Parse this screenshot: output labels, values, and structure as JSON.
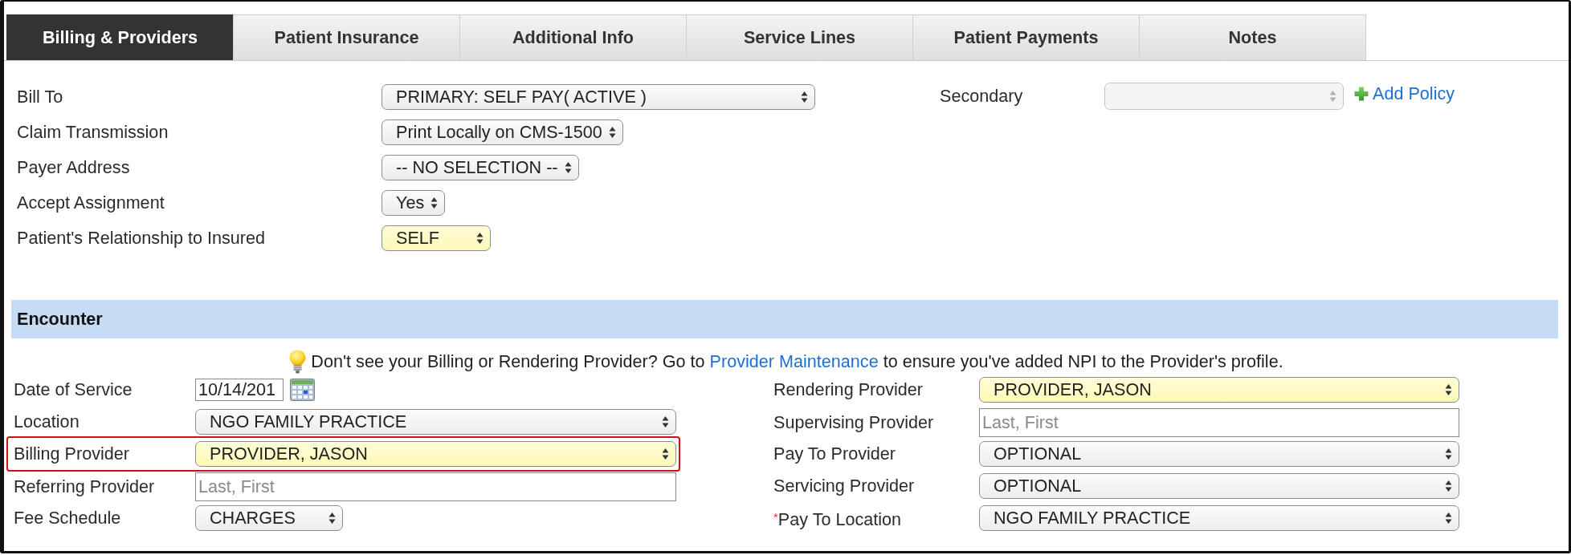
{
  "tabs": [
    {
      "label": "Billing & Providers",
      "selected": true
    },
    {
      "label": "Patient Insurance",
      "selected": false
    },
    {
      "label": "Additional Info",
      "selected": false
    },
    {
      "label": "Service Lines",
      "selected": false
    },
    {
      "label": "Patient Payments",
      "selected": false
    },
    {
      "label": "Notes",
      "selected": false
    }
  ],
  "billing": {
    "fields": [
      {
        "label": "Bill To",
        "value": "PRIMARY: SELF PAY( ACTIVE )",
        "highlighted": false
      },
      {
        "label": "Claim Transmission",
        "value": "Print Locally on CMS-1500",
        "highlighted": false
      },
      {
        "label": "Payer Address",
        "value": "-- NO SELECTION --",
        "highlighted": false
      },
      {
        "label": "Accept Assignment",
        "value": "Yes",
        "highlighted": false
      },
      {
        "label": "Patient's Relationship to Insured",
        "value": "SELF",
        "highlighted": true
      }
    ],
    "secondary": {
      "label": "Secondary",
      "disabled": true
    },
    "add_policy": {
      "label": "Add Policy"
    }
  },
  "encounter": {
    "title": "Encounter",
    "notice": {
      "text_before": "Don't see your Billing or Rendering Provider? Go to",
      "link": "Provider Maintenance",
      "text_after": "to ensure you've added NPI to the Provider's profile."
    },
    "left_fields": [
      {
        "kind": "date",
        "label": "Date of Service",
        "value": "10/14/201",
        "outlined": false
      },
      {
        "kind": "select",
        "label": "Location",
        "value": "NGO FAMILY PRACTICE",
        "highlighted": false,
        "outlined": false
      },
      {
        "kind": "select",
        "label": "Billing Provider",
        "value": "PROVIDER, JASON",
        "highlighted": true,
        "outlined": true
      },
      {
        "kind": "text",
        "label": "Referring Provider",
        "placeholder": "Last, First",
        "outlined": false
      },
      {
        "kind": "select",
        "label": "Fee Schedule",
        "value": "CHARGES",
        "highlighted": false,
        "outlined": false
      }
    ],
    "right_fields": [
      {
        "kind": "select",
        "label": "Rendering Provider",
        "value": "PROVIDER, JASON",
        "highlighted": true
      },
      {
        "kind": "text",
        "label": "Supervising Provider",
        "placeholder": "Last, First"
      },
      {
        "kind": "select",
        "label": "Pay To Provider",
        "value": "OPTIONAL",
        "highlighted": false
      },
      {
        "kind": "select",
        "label": "Servicing Provider",
        "value": "OPTIONAL",
        "highlighted": false
      },
      {
        "kind": "select",
        "label": "Pay To Location",
        "value": "NGO FAMILY PRACTICE",
        "highlighted": false,
        "required_mark": "*"
      }
    ]
  }
}
